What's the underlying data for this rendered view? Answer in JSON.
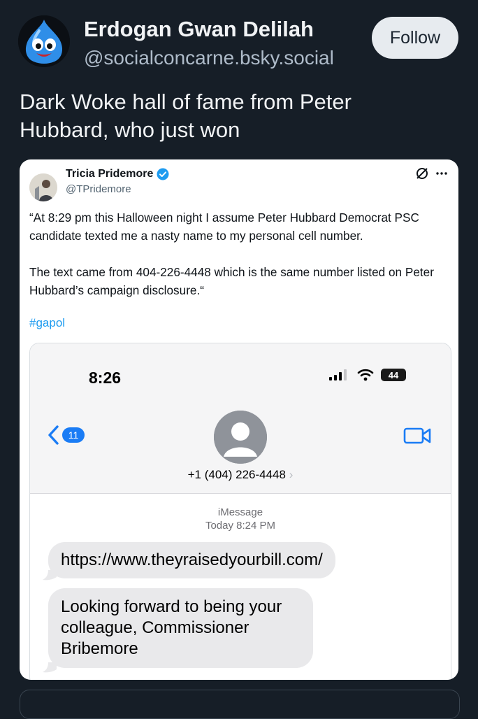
{
  "author": {
    "name": "Erdogan Gwan Delilah",
    "handle": "@socialconcarne.bsky.social",
    "follow_label": "Follow",
    "avatar_icon": "blue-slime-avatar-icon"
  },
  "post": {
    "text": "Dark Woke hall of fame from Peter Hubbard, who just won"
  },
  "embed": {
    "tweet": {
      "name": "Tricia Pridemore",
      "handle": "@TPridemore",
      "verified": true,
      "body": "“At 8:29 pm this Halloween night I assume Peter Hubbard Democrat PSC candidate texted me a nasty name to my personal cell number.\n\nThe text came from 404-226-4448 which is the same number listed on Peter Hubbard’s campaign disclosure.“",
      "hashtag": "#gapol",
      "more_icon": "more-dots-icon",
      "grok_icon": "slash-circle-icon"
    },
    "sms": {
      "time": "8:26",
      "battery": "44",
      "back_count": "11",
      "contact_number": "+1 (404) 226-4448",
      "contact_chevron": "›",
      "service_label": "iMessage",
      "timestamp": "Today 8:24 PM",
      "messages": [
        "https://www.theyraisedyourbill.com/",
        "Looking forward to being your colleague, Commissioner Bribemore"
      ]
    }
  },
  "colors": {
    "background": "#161e27",
    "link": "#1d9bf0",
    "imessage_blue": "#1a7cf5",
    "bubble_grey": "#e9e9eb"
  }
}
